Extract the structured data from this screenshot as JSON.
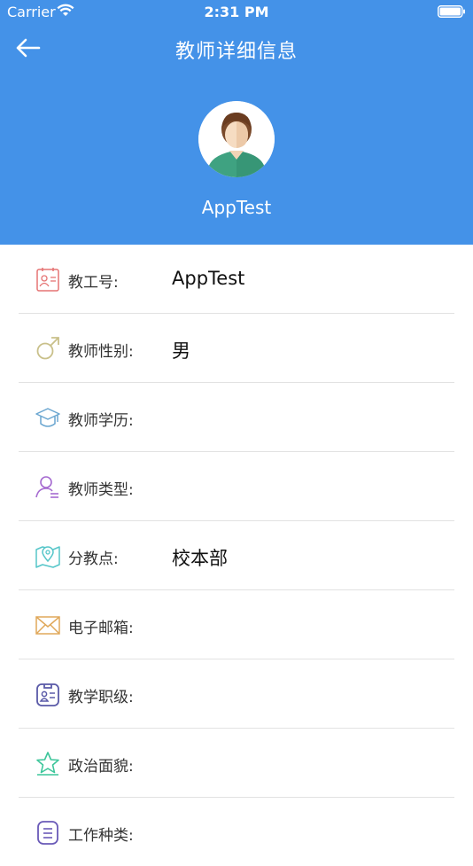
{
  "status_bar": {
    "carrier": "Carrier",
    "time": "2:31 PM"
  },
  "nav": {
    "title": "教师详细信息",
    "back_icon": "arrow-left-icon"
  },
  "profile": {
    "name": "AppTest",
    "avatar_icon": "user-avatar"
  },
  "colors": {
    "header_bg": "#4492e8",
    "divider": "#e2e2e2"
  },
  "fields": [
    {
      "label": "教工号:",
      "value": "AppTest",
      "icon": "id-card-icon"
    },
    {
      "label": "教师性别:",
      "value": "男",
      "icon": "male-icon"
    },
    {
      "label": "教师学历:",
      "value": "",
      "icon": "graduation-cap-icon"
    },
    {
      "label": "教师类型:",
      "value": "",
      "icon": "user-type-icon"
    },
    {
      "label": "分教点:",
      "value": "校本部",
      "icon": "map-pin-icon"
    },
    {
      "label": "电子邮箱:",
      "value": "",
      "icon": "envelope-icon"
    },
    {
      "label": "教学职级:",
      "value": "",
      "icon": "badge-icon"
    },
    {
      "label": "政治面貌:",
      "value": "",
      "icon": "star-icon"
    },
    {
      "label": "工作种类:",
      "value": "",
      "icon": "list-icon"
    }
  ]
}
